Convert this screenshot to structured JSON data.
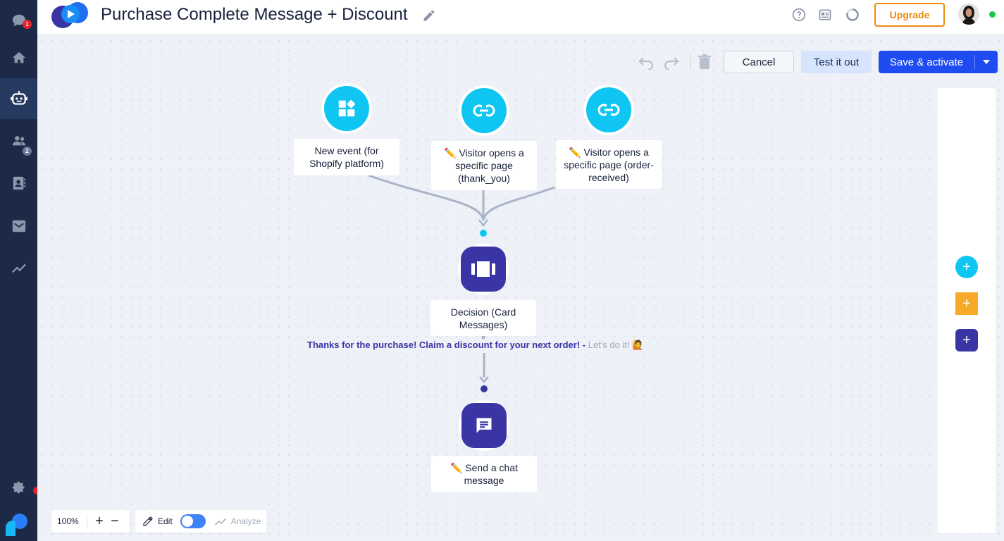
{
  "app": {
    "title": "Purchase Complete Message + Discount",
    "upgrade_label": "Upgrade",
    "online_status_color": "#1ec34a"
  },
  "sidebar": {
    "items": [
      {
        "name": "chat",
        "icon": "chat-bubble-icon",
        "badge": "1",
        "badge_color": "#e8202a"
      },
      {
        "name": "home",
        "icon": "home-icon"
      },
      {
        "name": "bots",
        "icon": "bot-icon",
        "active": true
      },
      {
        "name": "visitors",
        "icon": "people-icon",
        "badge": "2",
        "badge_color": "#6b7a96"
      },
      {
        "name": "contacts",
        "icon": "contacts-icon"
      },
      {
        "name": "mailing",
        "icon": "mail-icon"
      },
      {
        "name": "analytics",
        "icon": "chart-line-icon"
      },
      {
        "name": "settings",
        "icon": "gear-icon"
      }
    ]
  },
  "toolbar": {
    "cancel_label": "Cancel",
    "test_label": "Test it out",
    "save_label": "Save & activate"
  },
  "flow": {
    "triggers": [
      {
        "label": "New event (for Shopify platform)",
        "icon": "widgets-icon"
      },
      {
        "label": "✏️ Visitor opens a specific page (thank_you)",
        "icon": "link-icon"
      },
      {
        "label": "✏️ Visitor opens a specific page (order-received)",
        "icon": "link-icon"
      }
    ],
    "decision": {
      "label": "Decision (Card Messages)",
      "icon": "carousel-icon",
      "branch_text": "Thanks for the purchase! Claim a discount for your next order! -",
      "branch_action": "Let's do it! 🙋"
    },
    "action": {
      "label": "✏️ Send a chat message",
      "icon": "chat-message-icon"
    }
  },
  "bottom": {
    "zoom": "100%",
    "edit_label": "Edit",
    "analyze_label": "Analyze"
  },
  "colors": {
    "accent_cyan": "#0fc6f2",
    "accent_purple": "#3a35a4",
    "accent_orange": "#f7a928",
    "primary_blue": "#1f4cf1",
    "sidebar_bg": "#1c2a47"
  }
}
